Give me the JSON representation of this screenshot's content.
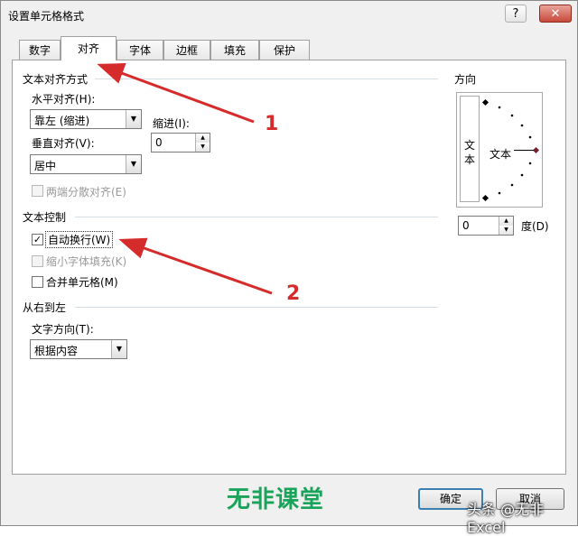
{
  "window": {
    "title": "设置单元格格式",
    "help_label": "?",
    "close_label": "✕"
  },
  "tabs": [
    {
      "label": "数字"
    },
    {
      "label": "对齐"
    },
    {
      "label": "字体"
    },
    {
      "label": "边框"
    },
    {
      "label": "填充"
    },
    {
      "label": "保护"
    }
  ],
  "active_tab": "对齐",
  "text_alignment": {
    "section_title": "文本对齐方式",
    "horizontal_label": "水平对齐(H):",
    "horizontal_value": "靠左 (缩进)",
    "indent_label": "缩进(I):",
    "indent_value": "0",
    "vertical_label": "垂直对齐(V):",
    "vertical_value": "居中",
    "justify_distributed_label": "两端分散对齐(E)"
  },
  "text_control": {
    "section_title": "文本控制",
    "wrap_text_label": "自动换行(W)",
    "wrap_text_checked": true,
    "shrink_to_fit_label": "缩小字体填充(K)",
    "merge_cells_label": "合并单元格(M)"
  },
  "rtl": {
    "section_title": "从右到左",
    "direction_label": "文字方向(T):",
    "direction_value": "根据内容"
  },
  "orientation": {
    "section_title": "方向",
    "vertical_text": "文本",
    "horizontal_text": "文本",
    "degrees_value": "0",
    "degrees_label": "度(D)"
  },
  "buttons": {
    "ok_label": "确定",
    "cancel_label": "取消"
  },
  "annotations": {
    "marker_1": "1",
    "marker_2": "2"
  },
  "watermark": {
    "text": "无非课堂"
  },
  "credit": {
    "text": "头条 @无非Excel"
  },
  "colors": {
    "arrow": "#d62b2b",
    "watermark": "#1aa35a",
    "ok_border": "#3c7fb1"
  }
}
